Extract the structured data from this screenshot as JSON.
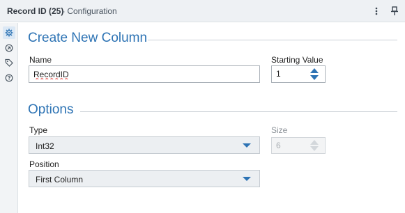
{
  "header": {
    "title": "Record ID (25)",
    "subtitle": "- Configuration",
    "menu_icon": "vertical-ellipsis-icon",
    "pin_icon": "pin-icon"
  },
  "sidebar": {
    "items": [
      {
        "name": "configuration",
        "icon": "gear-icon",
        "active": true
      },
      {
        "name": "annotation",
        "icon": "arrow-circle-icon",
        "active": false
      },
      {
        "name": "tags",
        "icon": "tag-icon",
        "active": false
      },
      {
        "name": "help",
        "icon": "help-icon",
        "active": false
      }
    ]
  },
  "create_section": {
    "title": "Create New Column",
    "name_label": "Name",
    "name_value": "RecordID",
    "starting_label": "Starting Value",
    "starting_value": "1"
  },
  "options_section": {
    "title": "Options",
    "type_label": "Type",
    "type_value": "Int32",
    "size_label": "Size",
    "size_value": "6",
    "position_label": "Position",
    "position_value": "First Column"
  },
  "colors": {
    "accent": "#2d73b4",
    "header_bg": "#eef1f4",
    "spellcheck": "#e0312d"
  }
}
